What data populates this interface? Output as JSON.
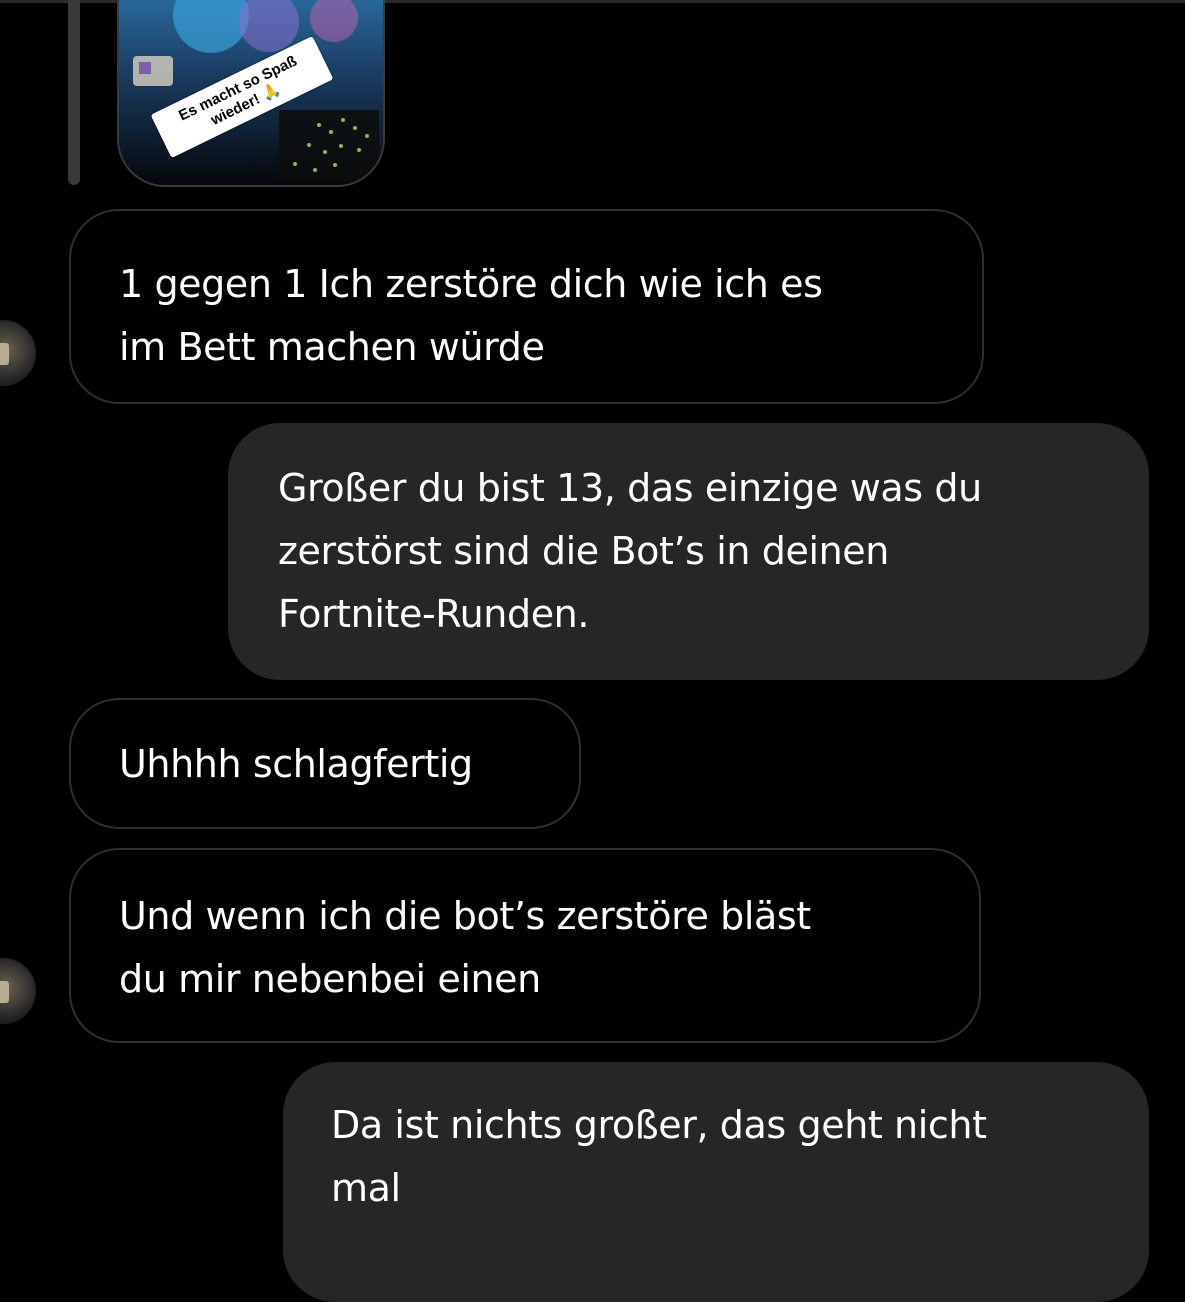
{
  "story_reply": {
    "thumbnail_icon": "story-image",
    "sticker_text": "Es macht so Spaß wieder! 🙏"
  },
  "messages": [
    {
      "sender": "them",
      "text": "1 gegen 1 Ich zerstöre dich wie ich es\nim Bett machen würde"
    },
    {
      "sender": "me",
      "text": "Großer du bist 13, das einzige was du\nzerstörst sind die Bot’s in deinen\nFortnite-Runden."
    },
    {
      "sender": "them",
      "text": "Uhhhh schlagfertig"
    },
    {
      "sender": "them",
      "text": "Und wenn ich die bot’s zerstöre bläst\ndu mir nebenbei einen"
    },
    {
      "sender": "me",
      "text": "Da ist nichts großer, das geht nicht\nmal"
    }
  ],
  "colors": {
    "background": "#000000",
    "incoming_border": "#2f2f2f",
    "outgoing_bubble": "#262626",
    "text": "#ffffff"
  }
}
